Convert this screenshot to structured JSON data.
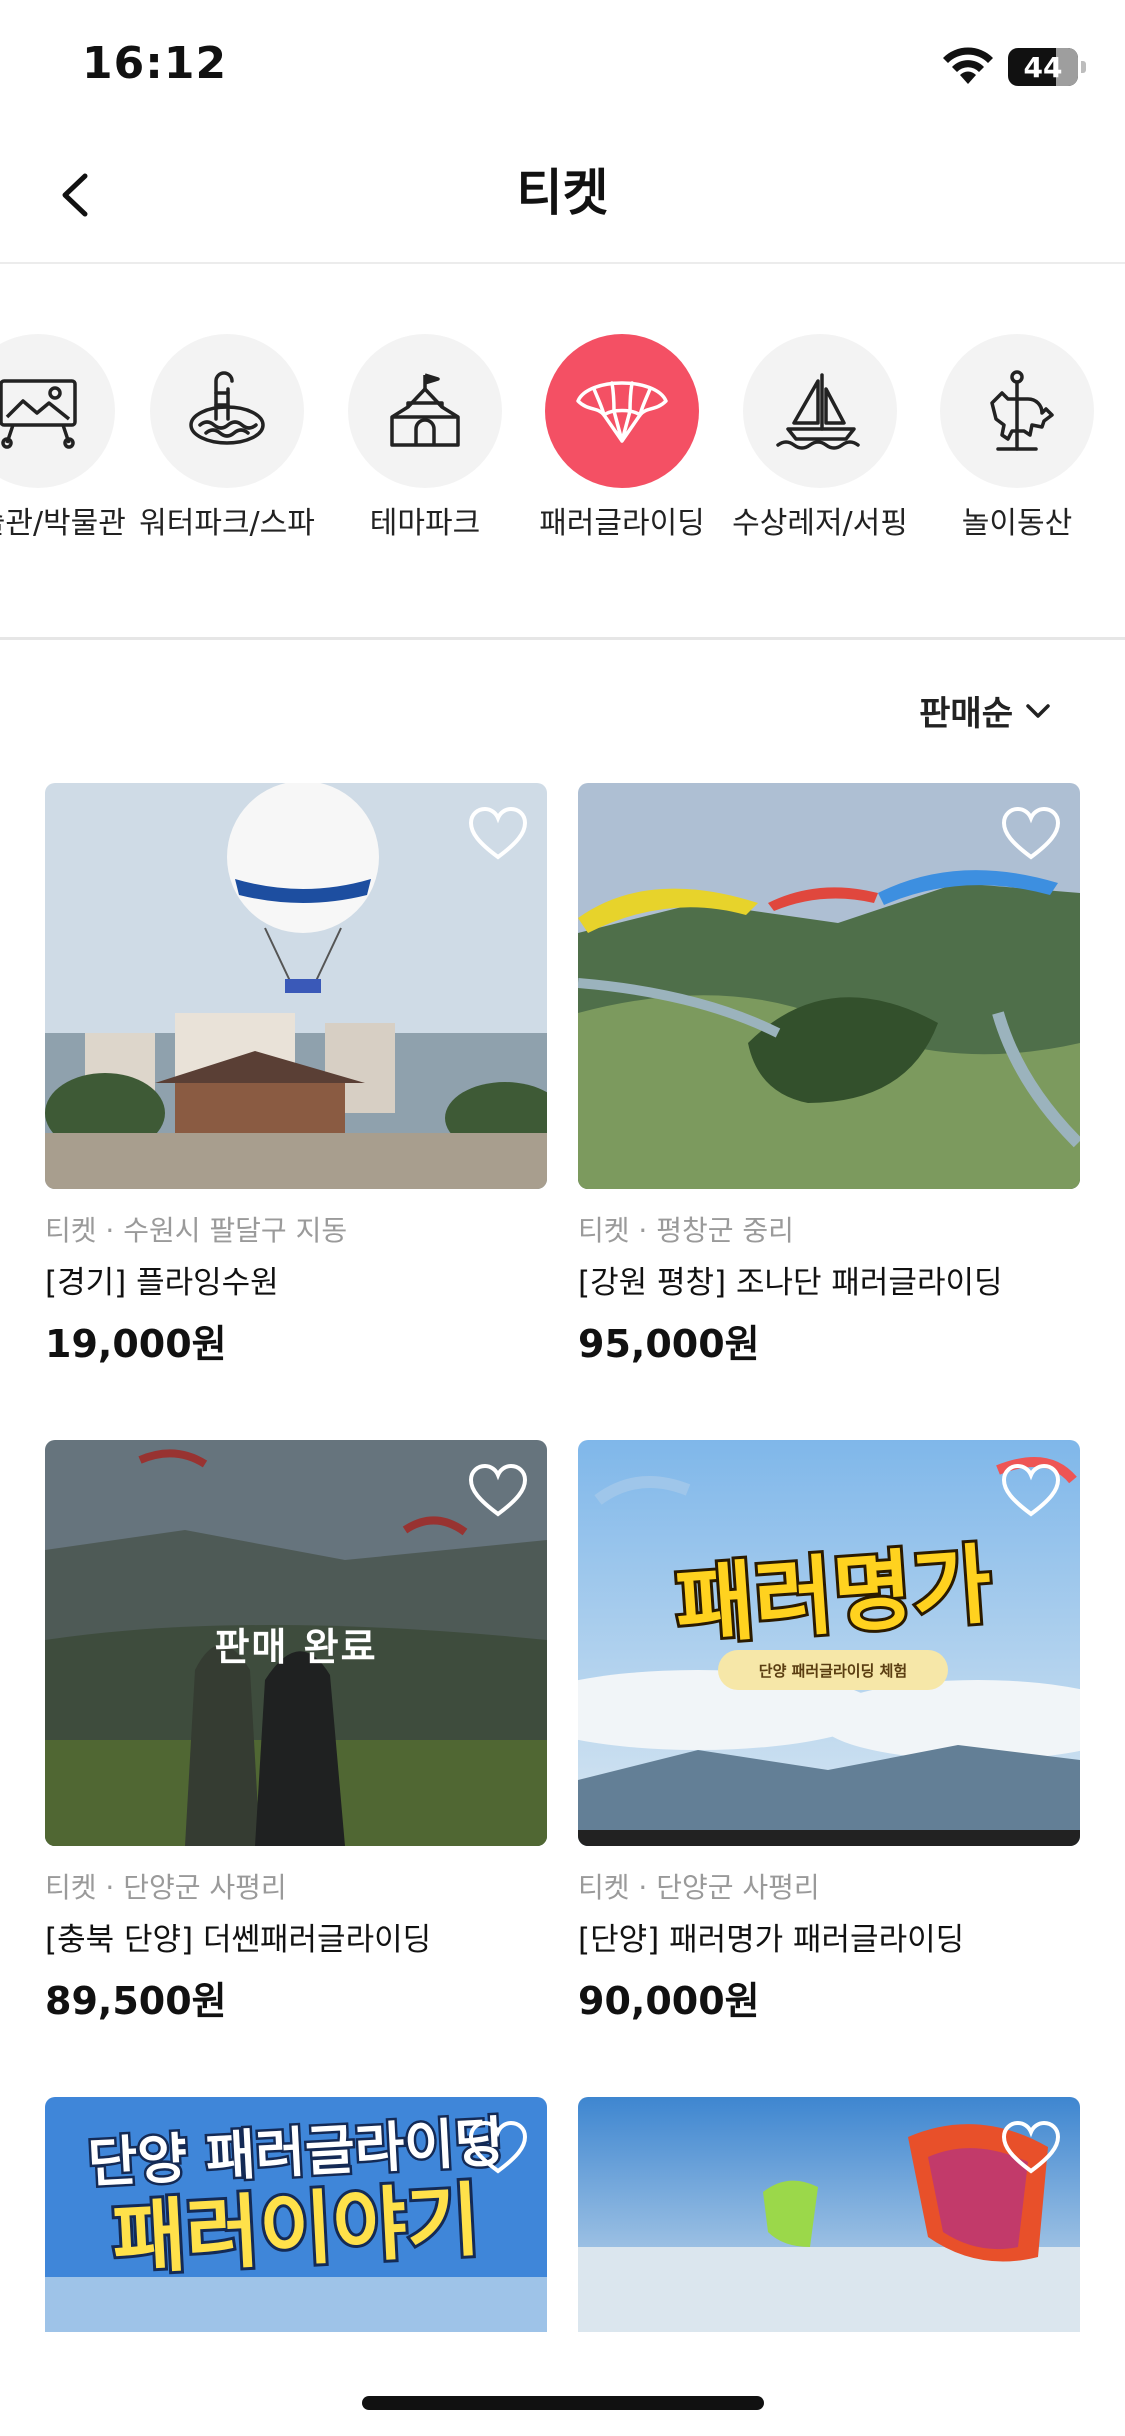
{
  "status": {
    "time": "16:12",
    "battery": "44"
  },
  "header": {
    "title": "티켓"
  },
  "categories": [
    {
      "label": "미술관/박물관",
      "icon": "museum-icon"
    },
    {
      "label": "워터파크/스파",
      "icon": "waterpark-icon"
    },
    {
      "label": "테마파크",
      "icon": "castle-icon"
    },
    {
      "label": "패러글라이딩",
      "icon": "paraglider-icon",
      "active": true
    },
    {
      "label": "수상레저/서핑",
      "icon": "sailboat-icon"
    },
    {
      "label": "놀이동산",
      "icon": "carousel-horse-icon"
    }
  ],
  "sort": {
    "label": "판매순"
  },
  "products": [
    {
      "meta": "티켓 · 수원시 팔달구 지동",
      "name": "[경기] 플라잉수원",
      "price": "19,000원"
    },
    {
      "meta": "티켓 · 평창군 중리",
      "name": "[강원 평창] 조나단 패러글라이딩",
      "price": "95,000원"
    },
    {
      "meta": "티켓 · 단양군 사평리",
      "name": "[충북 단양] 더쎈패러글라이딩",
      "price": "89,500원",
      "badge": "판매 완료"
    },
    {
      "meta": "티켓 · 단양군 사평리",
      "name": "[단양] 패러명가 패러글라이딩",
      "price": "90,000원",
      "image_title": "패러명가",
      "image_subtitle": "단양 패러글라이딩 체험"
    },
    {
      "image_title_top": "단양 패러글라이딩",
      "image_title": "패러이야기"
    },
    {}
  ],
  "colors": {
    "accent": "#f45064",
    "price": "#111111",
    "meta": "#9a9a9a"
  }
}
